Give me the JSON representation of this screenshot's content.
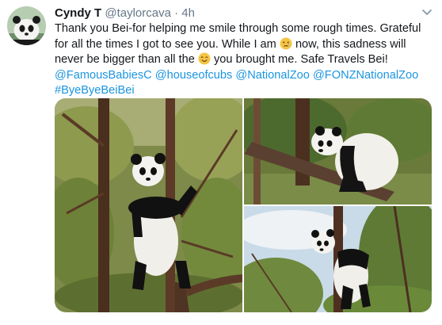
{
  "tweet": {
    "display_name": "Cyndy T",
    "handle": "@taylorcava",
    "separator": "·",
    "time": "4h",
    "text": {
      "part1": "Thank you Bei-for helping me smile through some rough times. Grateful for all the times I got to see you. While I am ",
      "part2": " now, this sadness will never be bigger than all the ",
      "part3": " you brought me. Safe Travels Bei! ",
      "mention1": "@FamousBabiesC",
      "mention2": "@houseofcubs",
      "mention3": "@NationalZoo",
      "mention4": "@FONZNationalZoo",
      "hashtag": "#ByeByeBeiBei"
    },
    "icons": {
      "sad_emoji": "crying-face-icon",
      "happy_emoji": "smiling-face-icon",
      "menu": "chevron-down-icon"
    },
    "colors": {
      "link": "#1b95e0",
      "secondary_text": "#657786",
      "text": "#14171a"
    }
  }
}
